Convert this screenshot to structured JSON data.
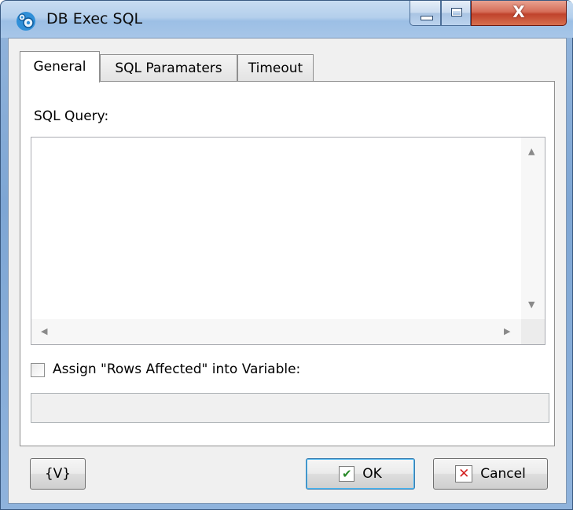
{
  "window": {
    "title": "DB Exec SQL",
    "close_glyph": "X",
    "icon": "app-gears-icon"
  },
  "tabs": [
    {
      "label": "General",
      "active": true
    },
    {
      "label": "SQL Paramaters",
      "active": false
    },
    {
      "label": "Timeout",
      "active": false
    }
  ],
  "general": {
    "sql_query_label": "SQL Query:",
    "sql_query_value": "",
    "assign_checkbox_label": "Assign \"Rows Affected\" into Variable:",
    "assign_checked": false,
    "variable_value": ""
  },
  "footer": {
    "var_button_label": "{V}",
    "ok_label": "OK",
    "cancel_label": "Cancel"
  },
  "colors": {
    "title_bar": "#b4cfec",
    "close_button": "#c0432c",
    "panel_bg": "#f0f0f0"
  }
}
